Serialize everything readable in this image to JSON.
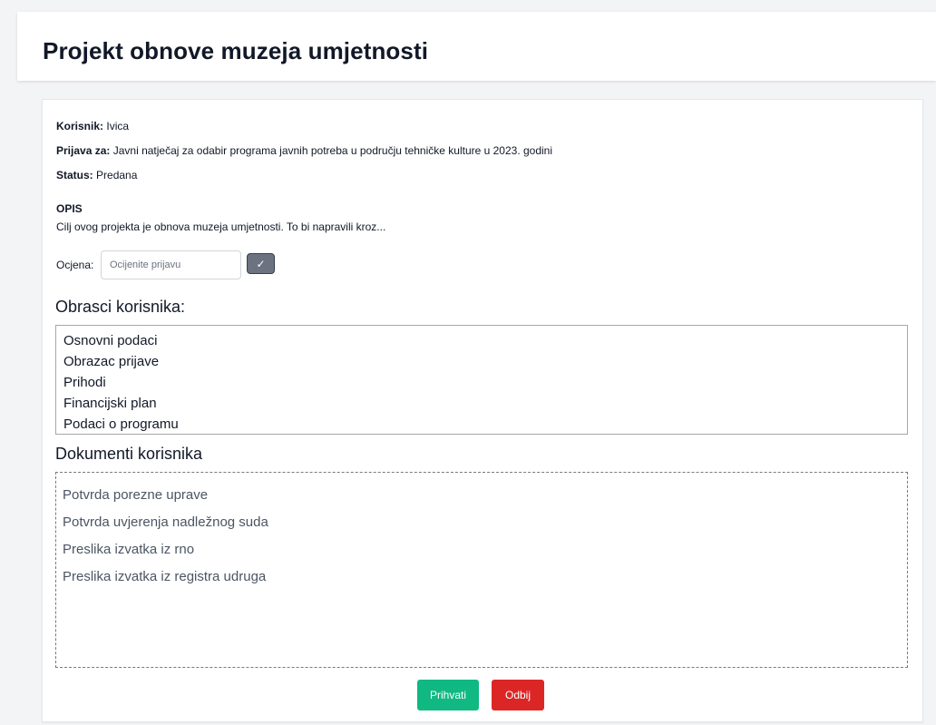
{
  "header": {
    "title": "Projekt obnove muzeja umjetnosti"
  },
  "details": {
    "user_label": "Korisnik:",
    "user_value": "Ivica",
    "application_label": "Prijava za:",
    "application_value": "Javni natječaj za odabir programa javnih potreba u području tehničke kulture u 2023. godini",
    "status_label": "Status:",
    "status_value": "Predana"
  },
  "description": {
    "title": "OPIS",
    "text": "Cilj ovog projekta je obnova muzeja umjetnosti. To bi napravili kroz..."
  },
  "rating": {
    "label": "Ocjena:",
    "placeholder": "Ocijenite prijavu",
    "value": "",
    "submit_icon": "check-icon",
    "submit_glyph": "✓"
  },
  "forms": {
    "title": "Obrasci korisnika:",
    "items": [
      {
        "label": "Osnovni podaci"
      },
      {
        "label": "Obrazac prijave"
      },
      {
        "label": "Prihodi"
      },
      {
        "label": "Financijski plan"
      },
      {
        "label": "Podaci o programu"
      }
    ]
  },
  "documents": {
    "title": "Dokumenti korisnika",
    "items": [
      {
        "label": "Potvrda porezne uprave"
      },
      {
        "label": "Potvrda uvjerenja nadležnog suda"
      },
      {
        "label": "Preslika izvatka iz rno"
      },
      {
        "label": "Preslika izvatka iz registra udruga"
      }
    ]
  },
  "actions": {
    "accept_label": "Prihvati",
    "reject_label": "Odbij"
  },
  "colors": {
    "accept": "#10b981",
    "reject": "#dc2626",
    "rating_button": "#6b7280",
    "background": "#f3f4f6"
  }
}
